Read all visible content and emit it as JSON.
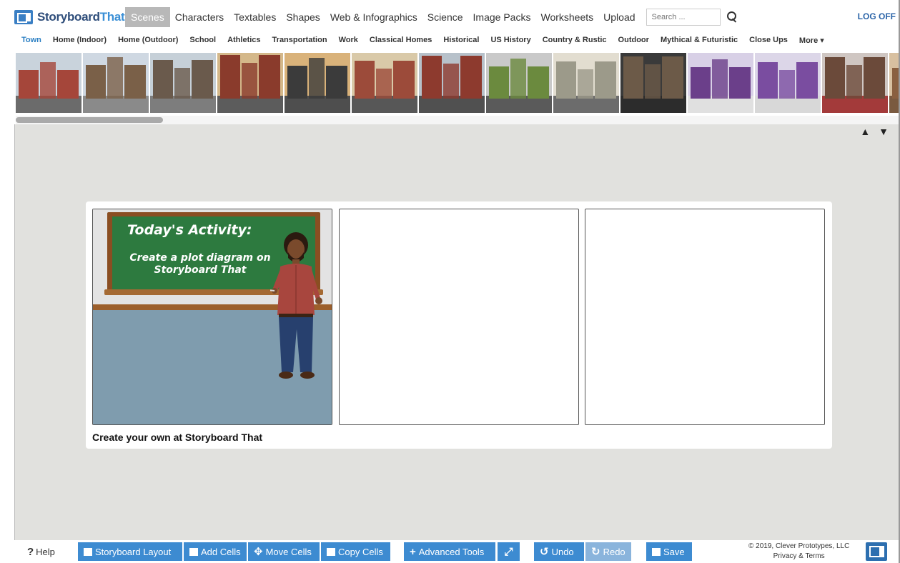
{
  "app": {
    "logo_story": "Storyboard",
    "logo_that": "That",
    "logoff_label": "LOG OFF"
  },
  "main_nav": [
    {
      "label": "Scenes",
      "active": true
    },
    {
      "label": "Characters"
    },
    {
      "label": "Textables"
    },
    {
      "label": "Shapes"
    },
    {
      "label": "Web & Infographics"
    },
    {
      "label": "Science"
    },
    {
      "label": "Image Packs"
    },
    {
      "label": "Worksheets"
    },
    {
      "label": "Upload"
    }
  ],
  "search": {
    "placeholder": "Search ..."
  },
  "sub_nav": [
    {
      "label": "Town",
      "active": true
    },
    {
      "label": "Home (Indoor)"
    },
    {
      "label": "Home (Outdoor)"
    },
    {
      "label": "School"
    },
    {
      "label": "Athletics"
    },
    {
      "label": "Transportation"
    },
    {
      "label": "Work"
    },
    {
      "label": "Classical Homes"
    },
    {
      "label": "Historical"
    },
    {
      "label": "US History"
    },
    {
      "label": "Country & Rustic"
    },
    {
      "label": "Outdoor"
    },
    {
      "label": "Mythical & Futuristic"
    },
    {
      "label": "Close Ups"
    },
    {
      "label": "More ▾"
    }
  ],
  "thumbnails": [
    {
      "sky": "#c9d3dc",
      "ground": "#6b6b6b",
      "building": "#a5463a"
    },
    {
      "sky": "#cfd8e2",
      "ground": "#8a8a8a",
      "building": "#7a6048"
    },
    {
      "sky": "#c6d0d8",
      "ground": "#7d7d7d",
      "building": "#6a5a4c"
    },
    {
      "sky": "#d4b88a",
      "ground": "#5c5c5c",
      "building": "#8a3b2c"
    },
    {
      "sky": "#d9b27a",
      "ground": "#4e4e4e",
      "building": "#3b3b3b"
    },
    {
      "sky": "#d9c9a8",
      "ground": "#575757",
      "building": "#9c4b3a"
    },
    {
      "sky": "#b7c1ca",
      "ground": "#505050",
      "building": "#8d3a2e"
    },
    {
      "sky": "#c9c9c9",
      "ground": "#5a5a5a",
      "building": "#6b8a3e"
    },
    {
      "sky": "#e2ddd0",
      "ground": "#6c6c6c",
      "building": "#9c9a8a"
    },
    {
      "sky": "#3a3a3a",
      "ground": "#2c2c2c",
      "building": "#6c5a48"
    },
    {
      "sky": "#d8d0e6",
      "ground": "#e0e0e0",
      "building": "#6b3f8a"
    },
    {
      "sky": "#dcd6e8",
      "ground": "#d8d8d8",
      "building": "#7a4da0"
    },
    {
      "sky": "#cfc6c2",
      "ground": "#a33a3a",
      "building": "#6b4a3a"
    },
    {
      "sky": "#d8c0a0",
      "ground": "#7a5a40",
      "building": "#8a6040"
    }
  ],
  "scroll_arrows": "▲ ▼",
  "storyboard": {
    "cells": [
      {
        "chalk_title": "Today's Activity:",
        "chalk_line1": "Create a plot diagram on",
        "chalk_line2": "Storyboard That"
      },
      {},
      {}
    ],
    "caption": "Create your own at Storyboard That"
  },
  "toolbar": {
    "help_label": "Help",
    "layout_label": "Storyboard Layout",
    "add_cells_label": "Add Cells",
    "move_cells_label": "Move Cells",
    "copy_cells_label": "Copy Cells",
    "advanced_label": "Advanced Tools",
    "undo_label": "Undo",
    "redo_label": "Redo",
    "save_label": "Save",
    "copyright": "© 2019, Clever Prototypes, LLC",
    "privacy": "Privacy & Terms"
  }
}
